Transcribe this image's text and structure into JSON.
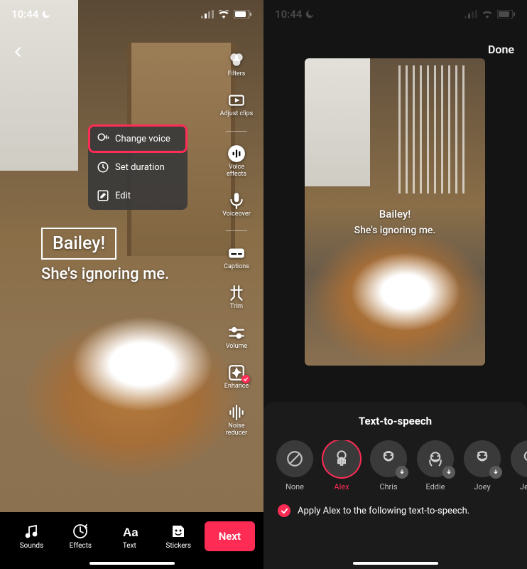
{
  "left": {
    "statusbar": {
      "time": "10:44"
    },
    "context_menu": [
      {
        "label": "Change voice",
        "highlight": true
      },
      {
        "label": "Set duration"
      },
      {
        "label": "Edit"
      }
    ],
    "caption": {
      "line1": "Bailey!",
      "line2": "She's ignoring me."
    },
    "side_tools": [
      {
        "label": "Filters"
      },
      {
        "label": "Adjust clips"
      },
      {
        "label": "Voice\neffects"
      },
      {
        "label": "Voiceover"
      },
      {
        "label": "Captions"
      },
      {
        "label": "Trim"
      },
      {
        "label": "Volume"
      },
      {
        "label": "Enhance"
      },
      {
        "label": "Noise\nreducer"
      }
    ],
    "bottom": {
      "sounds": "Sounds",
      "effects": "Effects",
      "text": "Text",
      "stickers": "Stickers",
      "next": "Next"
    }
  },
  "right": {
    "statusbar": {
      "time": "10:44"
    },
    "done": "Done",
    "preview_caption": {
      "line1": "Bailey!",
      "line2": "She's ignoring me."
    },
    "tts": {
      "title": "Text-to-speech",
      "voices": [
        "None",
        "Alex",
        "Chris",
        "Eddie",
        "Joey",
        "Jessi"
      ],
      "selected_index": 1,
      "apply_label": "Apply Alex to the following text-to-speech."
    }
  }
}
